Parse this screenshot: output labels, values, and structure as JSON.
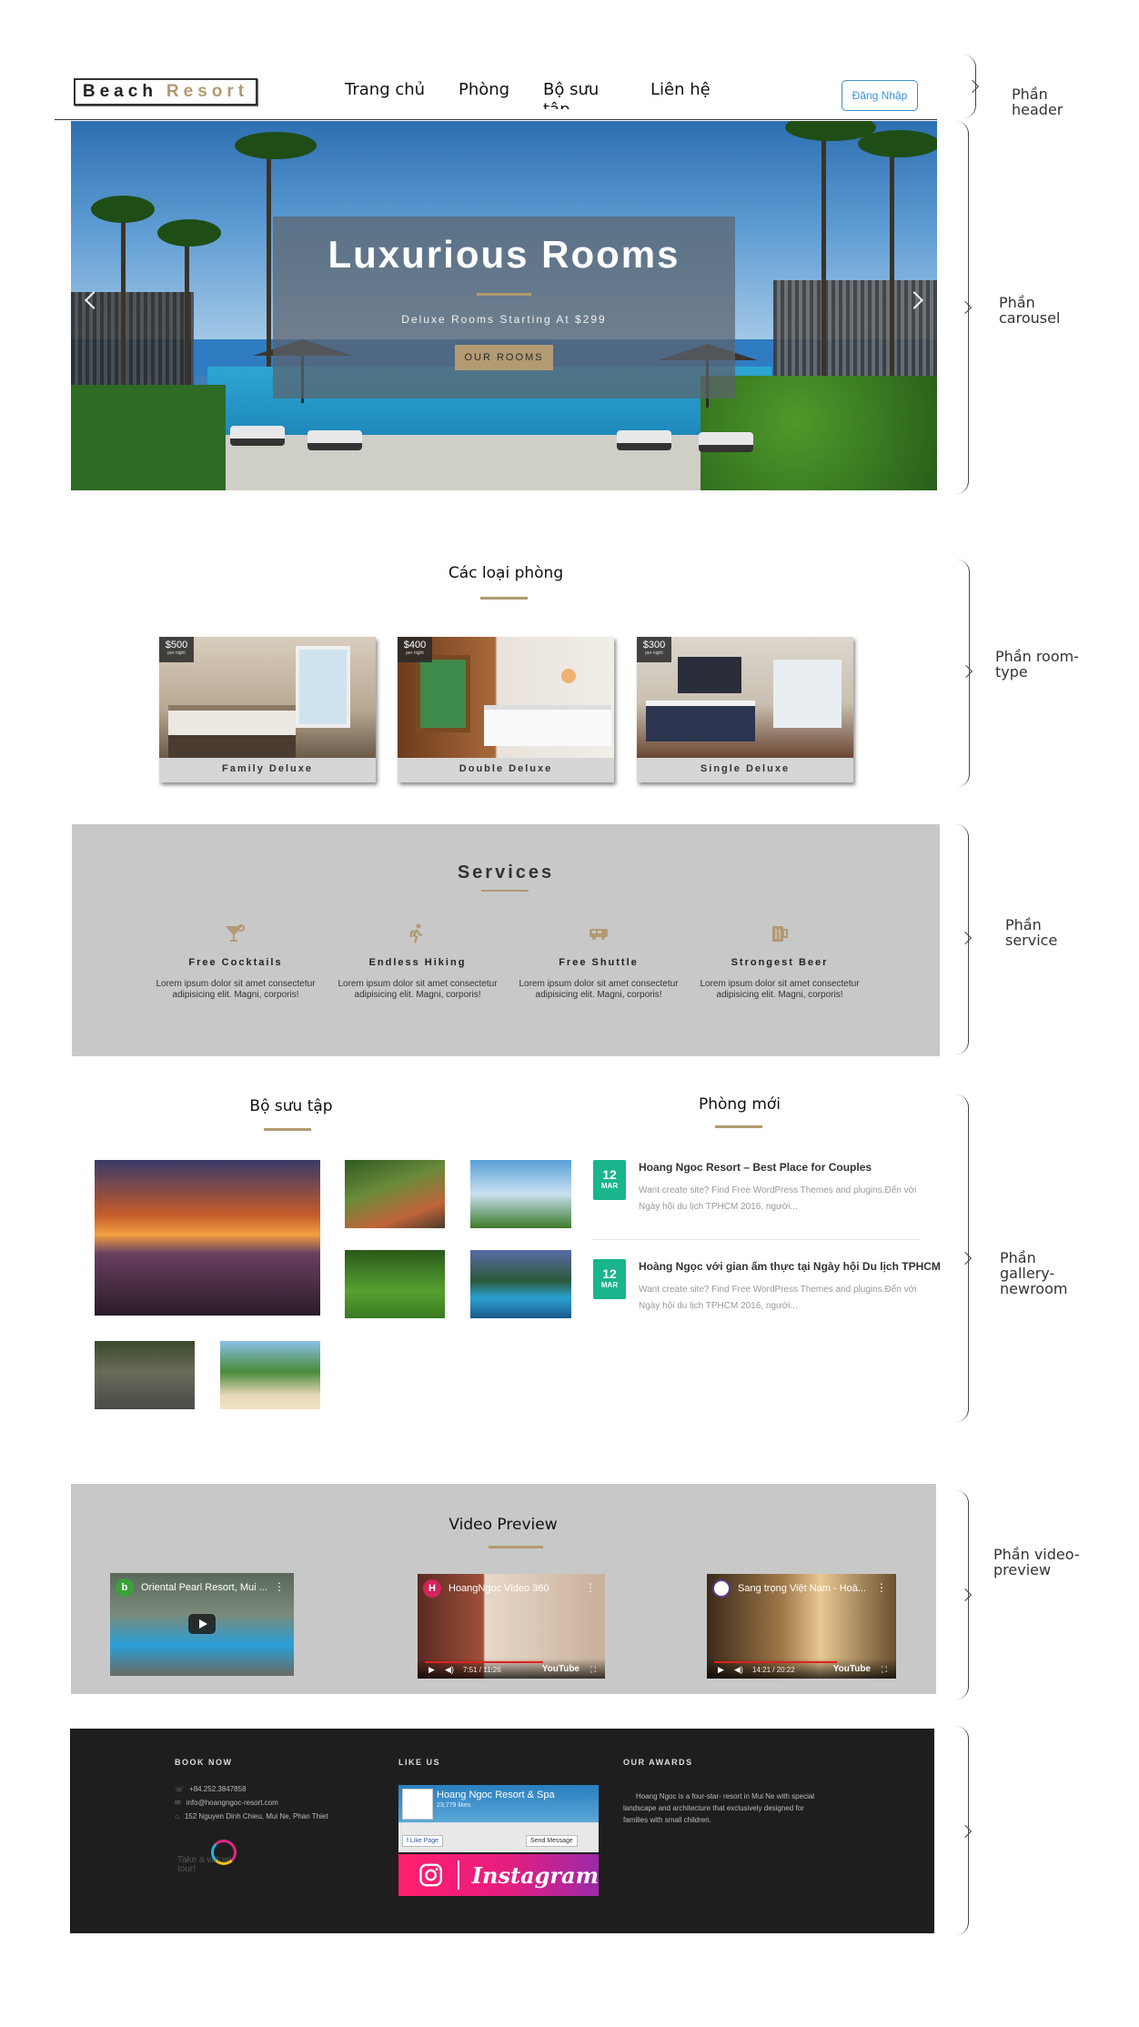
{
  "header": {
    "logo_part1": "Beach",
    "logo_part2": "Resort",
    "nav": [
      "Trang chủ",
      "Phòng",
      "Bộ sưu tập",
      "Liên hệ"
    ],
    "login_label": "Đăng Nhập"
  },
  "carousel": {
    "title": "Luxurious Rooms",
    "subtitle": "Deluxe Rooms Starting At $299",
    "button": "OUR ROOMS"
  },
  "room_types": {
    "heading": "Các loại phòng",
    "rooms": [
      {
        "price": "$500",
        "unit": "per night",
        "name": "Family Deluxe"
      },
      {
        "price": "$400",
        "unit": "per night",
        "name": "Double Deluxe"
      },
      {
        "price": "$300",
        "unit": "per night",
        "name": "Single Deluxe"
      }
    ]
  },
  "services": {
    "heading": "Services",
    "items": [
      {
        "icon": "cocktail-icon",
        "name": "Free Cocktails",
        "desc": "Lorem ipsum dolor sit amet consectetur adipisicing elit. Magni, corporis!"
      },
      {
        "icon": "hiking-icon",
        "name": "Endless Hiking",
        "desc": "Lorem ipsum dolor sit amet consectetur adipisicing elit. Magni, corporis!"
      },
      {
        "icon": "shuttle-icon",
        "name": "Free Shuttle",
        "desc": "Lorem ipsum dolor sit amet consectetur adipisicing elit. Magni, corporis!"
      },
      {
        "icon": "beer-icon",
        "name": "Strongest Beer",
        "desc": "Lorem ipsum dolor sit amet consectetur adipisicing elit. Magni, corporis!"
      }
    ]
  },
  "gallery": {
    "heading": "Bộ sưu tập"
  },
  "new_rooms": {
    "heading": "Phòng mới",
    "posts": [
      {
        "day": "12",
        "month": "MAR",
        "title": "Hoang Ngoc Resort – Best Place for Couples",
        "excerpt": "Want create site? Find Free WordPress Themes and plugins.Đến với Ngày hội du lịch TPHCM 2016, người..."
      },
      {
        "day": "12",
        "month": "MAR",
        "title": "Hoàng Ngọc với gian ấm thực tại Ngày hội Du lịch TPHCM",
        "excerpt": "Want create site? Find Free WordPress Themes and plugins.Đến với Ngày hội du lịch TPHCM 2016, người..."
      }
    ]
  },
  "video": {
    "heading": "Video Preview",
    "items": [
      {
        "avatar": "b",
        "title": "Oriental Pearl Resort, Mui ...",
        "time": ""
      },
      {
        "avatar": "H",
        "title": "HoangNgoc Video 360",
        "time": "7:51 / 11:26",
        "brand": "YouTube"
      },
      {
        "avatar": "",
        "title": "Sang trọng Việt Nam - Hoà...",
        "time": "14:21 / 20:22",
        "brand": "YouTube"
      }
    ]
  },
  "footer": {
    "book_now": "BOOK NOW",
    "phone": "+84.252.3847858",
    "email": "info@hoangngoc-resort.com",
    "address": "152 Nguyen Dinh Chieu, Mui Ne, Phan Thiet",
    "tour_text": "Take a virtual tour!",
    "like_us": "LIKE US",
    "fb_name": "Hoang Ngoc Resort & Spa",
    "fb_likes": "23,779 likes",
    "fb_like_btn": "Like Page",
    "fb_msg_btn": "Send Message",
    "instagram": "Instagram",
    "awards_head": "OUR AWARDS",
    "awards_text": "Hoang Ngoc is a four-star- resort in Mui Ne with special landscape and architecture that exclusively designed for families with small children."
  },
  "annotations": {
    "header": "Phần\nheader",
    "carousel": "Phần\ncarousel",
    "room_type": "Phần room-\ntype",
    "service": "Phần\nservice",
    "gallery": "Phần\ngallery-\nnewroom",
    "video": "Phần video-\npreview"
  },
  "colors": {
    "accent": "#b29a72",
    "news_date": "#19b58c",
    "login": "#3d8fd6"
  }
}
